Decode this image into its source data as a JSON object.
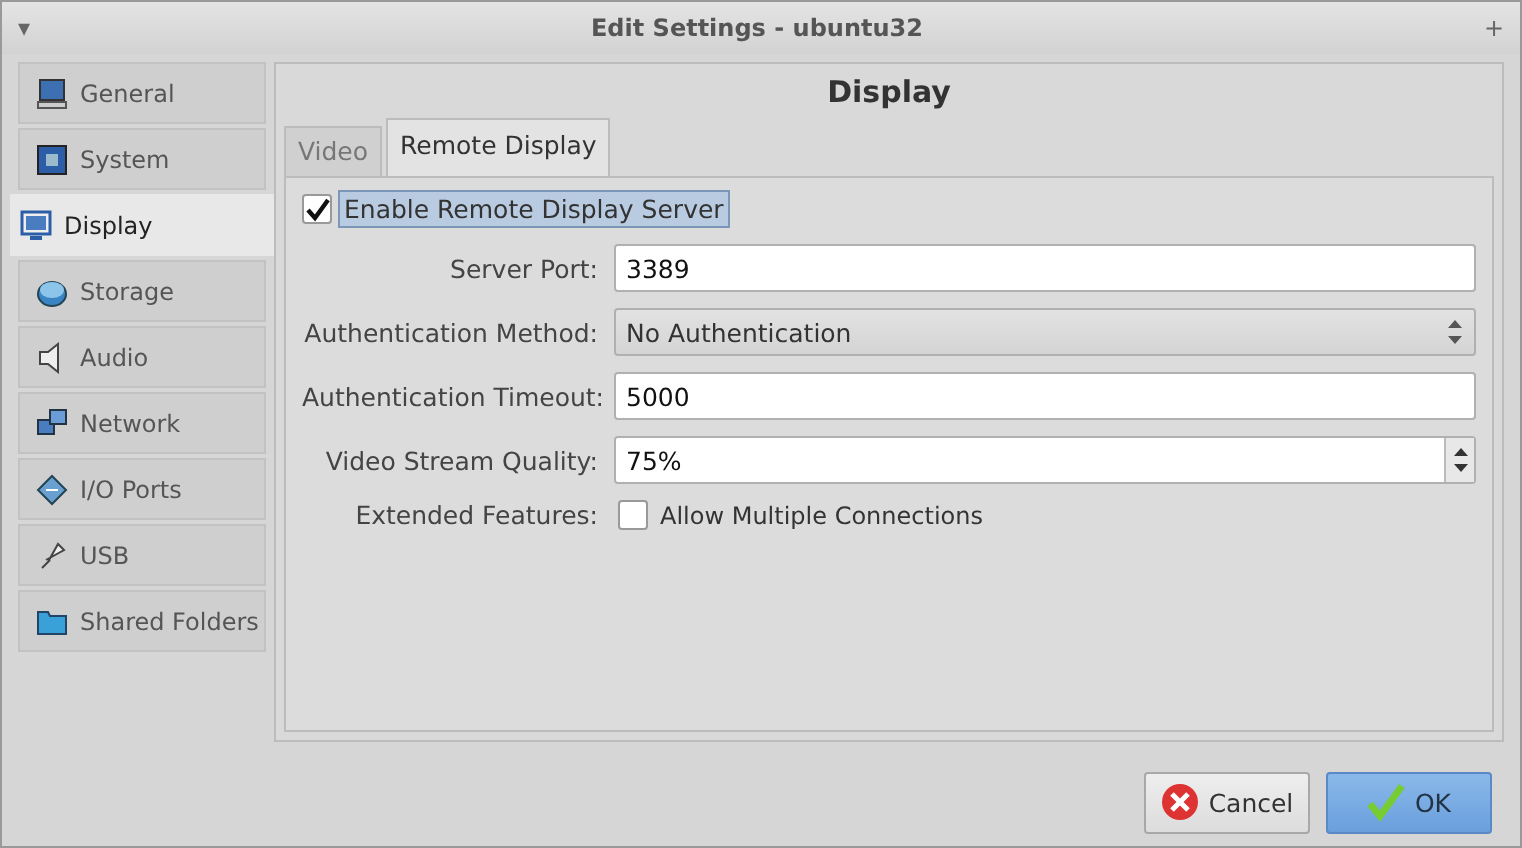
{
  "window": {
    "title": "Edit Settings - ubuntu32",
    "menu_glyph": "▾",
    "extra_glyph": "+"
  },
  "sidebar": {
    "items": [
      {
        "label": "General",
        "kind": "monitor",
        "selected": false
      },
      {
        "label": "System",
        "kind": "chip",
        "selected": false
      },
      {
        "label": "Display",
        "kind": "display",
        "selected": true
      },
      {
        "label": "Storage",
        "kind": "disk",
        "selected": false
      },
      {
        "label": "Audio",
        "kind": "speaker",
        "selected": false
      },
      {
        "label": "Network",
        "kind": "network",
        "selected": false
      },
      {
        "label": "I/O Ports",
        "kind": "port",
        "selected": false
      },
      {
        "label": "USB",
        "kind": "usb",
        "selected": false
      },
      {
        "label": "Shared Folders",
        "kind": "folder",
        "selected": false
      }
    ]
  },
  "page": {
    "title": "Display",
    "tabs": [
      {
        "label": "Video",
        "selected": false
      },
      {
        "label": "Remote Display",
        "selected": true
      }
    ],
    "enable": {
      "label": "Enable Remote Display Server",
      "checked": true,
      "focused": true
    },
    "fields": [
      {
        "kind": "text",
        "label": "Server Port:",
        "value": "3389"
      },
      {
        "kind": "combo",
        "label": "Authentication Method:",
        "value": "No Authentication"
      },
      {
        "kind": "text",
        "label": "Authentication Timeout:",
        "value": "5000"
      },
      {
        "kind": "spin",
        "label": "Video Stream Quality:",
        "value": "75%"
      },
      {
        "kind": "checkbox",
        "label": "Extended Features:",
        "value": "Allow Multiple Connections",
        "checked": false
      }
    ]
  },
  "buttons": [
    {
      "label": "Cancel",
      "kind": "cancel",
      "default": false
    },
    {
      "label": "OK",
      "kind": "ok",
      "default": true
    }
  ]
}
